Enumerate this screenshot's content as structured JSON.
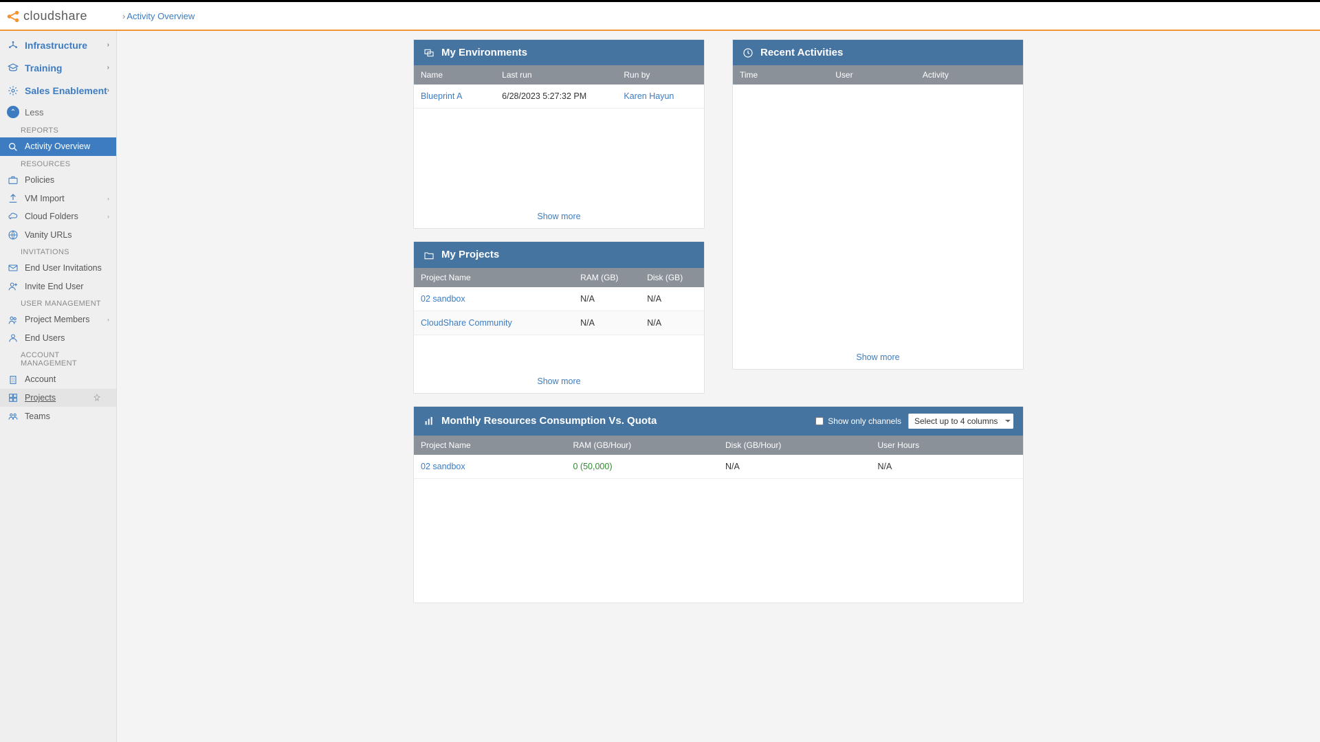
{
  "brand": "cloudshare",
  "breadcrumb": "Activity Overview",
  "nav": {
    "top": [
      {
        "label": "Infrastructure",
        "icon": "network"
      },
      {
        "label": "Training",
        "icon": "grad"
      },
      {
        "label": "Sales Enablement",
        "icon": "gear"
      }
    ],
    "less": "Less",
    "sections": [
      {
        "title": "REPORTS",
        "items": [
          {
            "label": "Activity Overview",
            "icon": "search",
            "active": true
          }
        ]
      },
      {
        "title": "RESOURCES",
        "items": [
          {
            "label": "Policies",
            "icon": "briefcase"
          },
          {
            "label": "VM Import",
            "icon": "upload",
            "chev": true
          },
          {
            "label": "Cloud Folders",
            "icon": "folder",
            "chev": true
          },
          {
            "label": "Vanity URLs",
            "icon": "globe"
          }
        ]
      },
      {
        "title": "INVITATIONS",
        "items": [
          {
            "label": "End User Invitations",
            "icon": "mail"
          },
          {
            "label": "Invite End User",
            "icon": "userplus"
          }
        ]
      },
      {
        "title": "USER MANAGEMENT",
        "items": [
          {
            "label": "Project Members",
            "icon": "users",
            "chev": true
          },
          {
            "label": "End Users",
            "icon": "user"
          }
        ]
      },
      {
        "title": "ACCOUNT MANAGEMENT",
        "items": [
          {
            "label": "Account",
            "icon": "building"
          },
          {
            "label": "Projects",
            "icon": "grid",
            "hovered": true,
            "pin": true
          },
          {
            "label": "Teams",
            "icon": "team"
          }
        ]
      }
    ]
  },
  "panels": {
    "environments": {
      "title": "My Environments",
      "cols": [
        "Name",
        "Last run",
        "Run by"
      ],
      "rows": [
        {
          "name": "Blueprint A",
          "lastrun": "6/28/2023 5:27:32 PM",
          "runby": "Karen Hayun"
        }
      ],
      "showmore": "Show more"
    },
    "projects": {
      "title": "My Projects",
      "cols": [
        "Project Name",
        "RAM (GB)",
        "Disk (GB)"
      ],
      "rows": [
        {
          "name": "02 sandbox",
          "ram": "N/A",
          "disk": "N/A"
        },
        {
          "name": "CloudShare Community",
          "ram": "N/A",
          "disk": "N/A"
        }
      ],
      "showmore": "Show more"
    },
    "activities": {
      "title": "Recent Activities",
      "cols": [
        "Time",
        "User",
        "Activity"
      ],
      "showmore": "Show more"
    },
    "consumption": {
      "title": "Monthly Resources Consumption Vs. Quota",
      "checkbox_label": "Show only channels",
      "select_label": "Select up to 4 columns",
      "cols": [
        "Project Name",
        "RAM (GB/Hour)",
        "Disk (GB/Hour)",
        "User Hours"
      ],
      "rows": [
        {
          "name": "02 sandbox",
          "ram": "0 (50,000)",
          "disk": "N/A",
          "hours": "N/A"
        }
      ]
    }
  }
}
